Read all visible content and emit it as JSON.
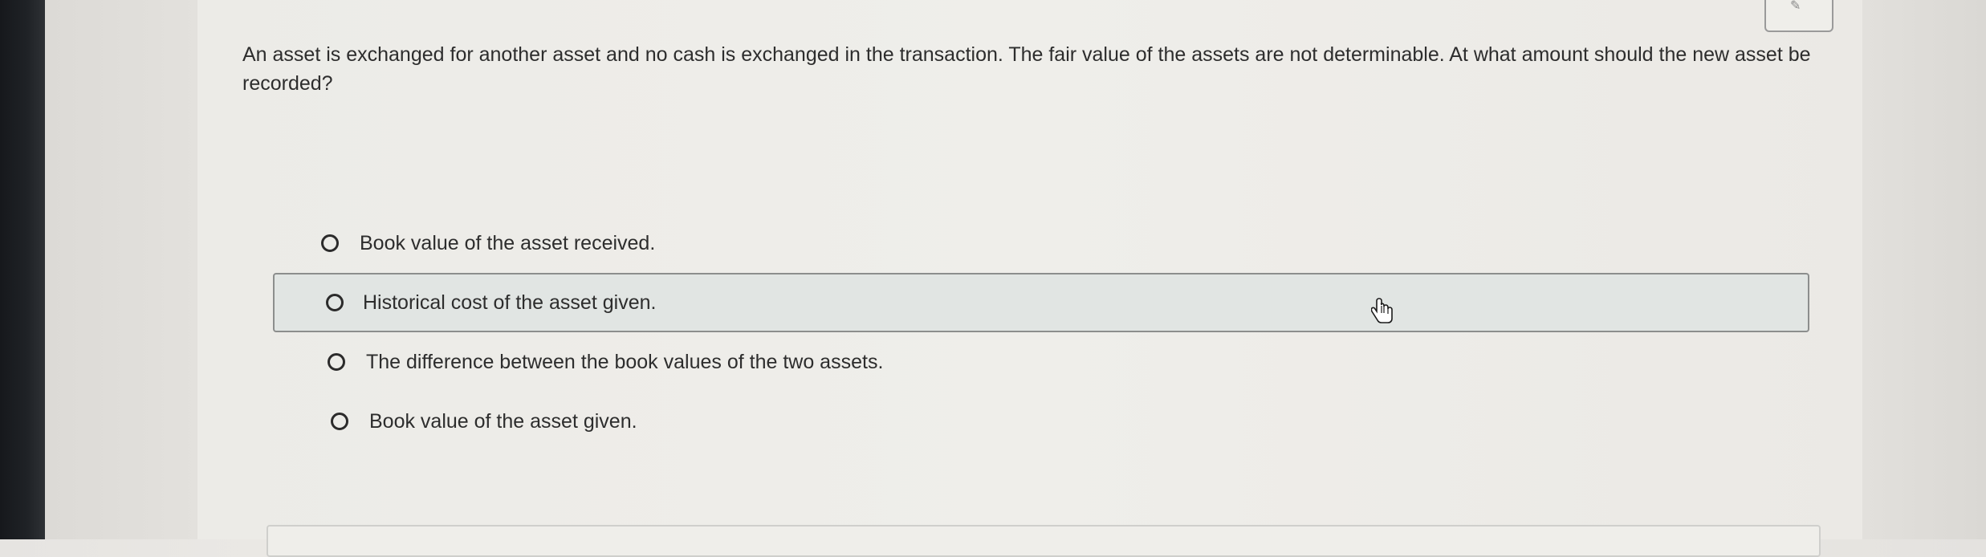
{
  "question": {
    "text": "An asset is exchanged for another asset and no cash is exchanged in the transaction. The fair value of the assets are not determinable. At what amount should the new asset be recorded?"
  },
  "choices": [
    {
      "label": "Book value of the asset received.",
      "selected": false,
      "hovered": false
    },
    {
      "label": "Historical cost of the asset given.",
      "selected": false,
      "hovered": true
    },
    {
      "label": "The difference between the book values of the two assets.",
      "selected": false,
      "hovered": false
    },
    {
      "label": "Book value of the asset given.",
      "selected": false,
      "hovered": false
    }
  ],
  "icons": {
    "cursor": "hand-pointer-icon",
    "top_button": "top-right-button"
  }
}
